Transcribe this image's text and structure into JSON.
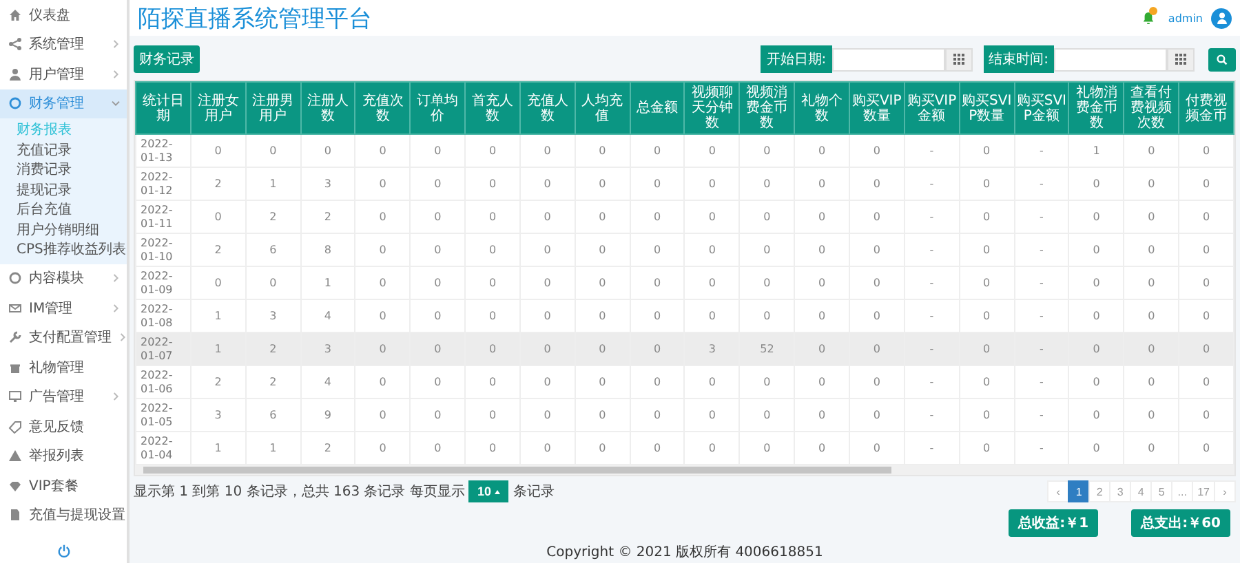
{
  "sidebar": {
    "items": [
      {
        "label": "仪表盘",
        "selected": false
      },
      {
        "label": "系统管理",
        "selected": false,
        "expanded": false
      },
      {
        "label": "用户管理",
        "selected": false,
        "expanded": false
      },
      {
        "label": "财务管理",
        "selected": true,
        "expanded": true,
        "children": [
          {
            "label": "财务报表",
            "selected": true
          },
          {
            "label": "充值记录",
            "selected": false
          },
          {
            "label": "消费记录",
            "selected": false
          },
          {
            "label": "提现记录",
            "selected": false
          },
          {
            "label": "后台充值",
            "selected": false
          },
          {
            "label": "用户分销明细",
            "selected": false
          },
          {
            "label": "CPS推荐收益列表",
            "selected": false
          }
        ]
      },
      {
        "label": "内容模块",
        "selected": false,
        "expanded": false
      },
      {
        "label": "IM管理",
        "selected": false,
        "expanded": false
      },
      {
        "label": "支付配置管理",
        "selected": false,
        "expanded": false
      },
      {
        "label": "礼物管理",
        "selected": false
      },
      {
        "label": "广告管理",
        "selected": false,
        "expanded": false
      },
      {
        "label": "意见反馈",
        "selected": false
      },
      {
        "label": "举报列表",
        "selected": false
      },
      {
        "label": "VIP套餐",
        "selected": false
      },
      {
        "label": "充值与提现设置",
        "selected": false
      }
    ]
  },
  "header": {
    "title": "陌探直播系统管理平台",
    "user": "admin"
  },
  "toolbar": {
    "records_button": "财务记录",
    "start_label": "开始日期:",
    "end_label": "结束时间:"
  },
  "table": {
    "columns": [
      "统计日期",
      "注册女用户",
      "注册男用户",
      "注册人数",
      "充值次数",
      "订单均价",
      "首充人数",
      "充值人数",
      "人均充值",
      "总金额",
      "视频聊天分钟数",
      "视频消费金币数",
      "礼物个数",
      "购买VIP数量",
      "购买VIP金额",
      "购买SVIP数量",
      "购买SVIP金额",
      "礼物消费金币数",
      "查看付费视频次数",
      "付费视频金币"
    ],
    "rows": [
      {
        "highlighted": false,
        "cells": [
          "2022-01-13",
          "0",
          "0",
          "0",
          "0",
          "0",
          "0",
          "0",
          "0",
          "0",
          "0",
          "0",
          "0",
          "0",
          "-",
          "0",
          "-",
          "1",
          "0",
          "0"
        ]
      },
      {
        "highlighted": false,
        "cells": [
          "2022-01-12",
          "2",
          "1",
          "3",
          "0",
          "0",
          "0",
          "0",
          "0",
          "0",
          "0",
          "0",
          "0",
          "0",
          "-",
          "0",
          "-",
          "0",
          "0",
          "0"
        ]
      },
      {
        "highlighted": false,
        "cells": [
          "2022-01-11",
          "0",
          "2",
          "2",
          "0",
          "0",
          "0",
          "0",
          "0",
          "0",
          "0",
          "0",
          "0",
          "0",
          "-",
          "0",
          "-",
          "0",
          "0",
          "0"
        ]
      },
      {
        "highlighted": false,
        "cells": [
          "2022-01-10",
          "2",
          "6",
          "8",
          "0",
          "0",
          "0",
          "0",
          "0",
          "0",
          "0",
          "0",
          "0",
          "0",
          "-",
          "0",
          "-",
          "0",
          "0",
          "0"
        ]
      },
      {
        "highlighted": false,
        "cells": [
          "2022-01-09",
          "0",
          "0",
          "1",
          "0",
          "0",
          "0",
          "0",
          "0",
          "0",
          "0",
          "0",
          "0",
          "0",
          "-",
          "0",
          "-",
          "0",
          "0",
          "0"
        ]
      },
      {
        "highlighted": false,
        "cells": [
          "2022-01-08",
          "1",
          "3",
          "4",
          "0",
          "0",
          "0",
          "0",
          "0",
          "0",
          "0",
          "0",
          "0",
          "0",
          "-",
          "0",
          "-",
          "0",
          "0",
          "0"
        ]
      },
      {
        "highlighted": true,
        "cells": [
          "2022-01-07",
          "1",
          "2",
          "3",
          "0",
          "0",
          "0",
          "0",
          "0",
          "0",
          "3",
          "52",
          "0",
          "0",
          "-",
          "0",
          "-",
          "0",
          "0",
          "0"
        ]
      },
      {
        "highlighted": false,
        "cells": [
          "2022-01-06",
          "2",
          "2",
          "4",
          "0",
          "0",
          "0",
          "0",
          "0",
          "0",
          "0",
          "0",
          "0",
          "0",
          "-",
          "0",
          "-",
          "0",
          "0",
          "0"
        ]
      },
      {
        "highlighted": false,
        "cells": [
          "2022-01-05",
          "3",
          "6",
          "9",
          "0",
          "0",
          "0",
          "0",
          "0",
          "0",
          "0",
          "0",
          "0",
          "0",
          "-",
          "0",
          "-",
          "0",
          "0",
          "0"
        ]
      },
      {
        "highlighted": false,
        "cells": [
          "2022-01-04",
          "1",
          "1",
          "2",
          "0",
          "0",
          "0",
          "0",
          "0",
          "0",
          "0",
          "0",
          "0",
          "0",
          "-",
          "0",
          "-",
          "0",
          "0",
          "0"
        ]
      }
    ]
  },
  "pagination": {
    "summary": "显示第 1 到第 10 条记录，总共 163 条记录 每页显示",
    "page_size": "10",
    "suffix": "条记录",
    "pages": [
      {
        "label": "‹",
        "selected": false
      },
      {
        "label": "1",
        "selected": true
      },
      {
        "label": "2",
        "selected": false
      },
      {
        "label": "3",
        "selected": false
      },
      {
        "label": "4",
        "selected": false
      },
      {
        "label": "5",
        "selected": false
      },
      {
        "label": "...",
        "selected": false
      },
      {
        "label": "17",
        "selected": false
      },
      {
        "label": "›",
        "selected": false
      }
    ]
  },
  "totals": [
    "总收益:￥1",
    "总支出:￥60"
  ],
  "footer": {
    "copyright": "Copyright © 2021 版权所有 4006618851"
  }
}
